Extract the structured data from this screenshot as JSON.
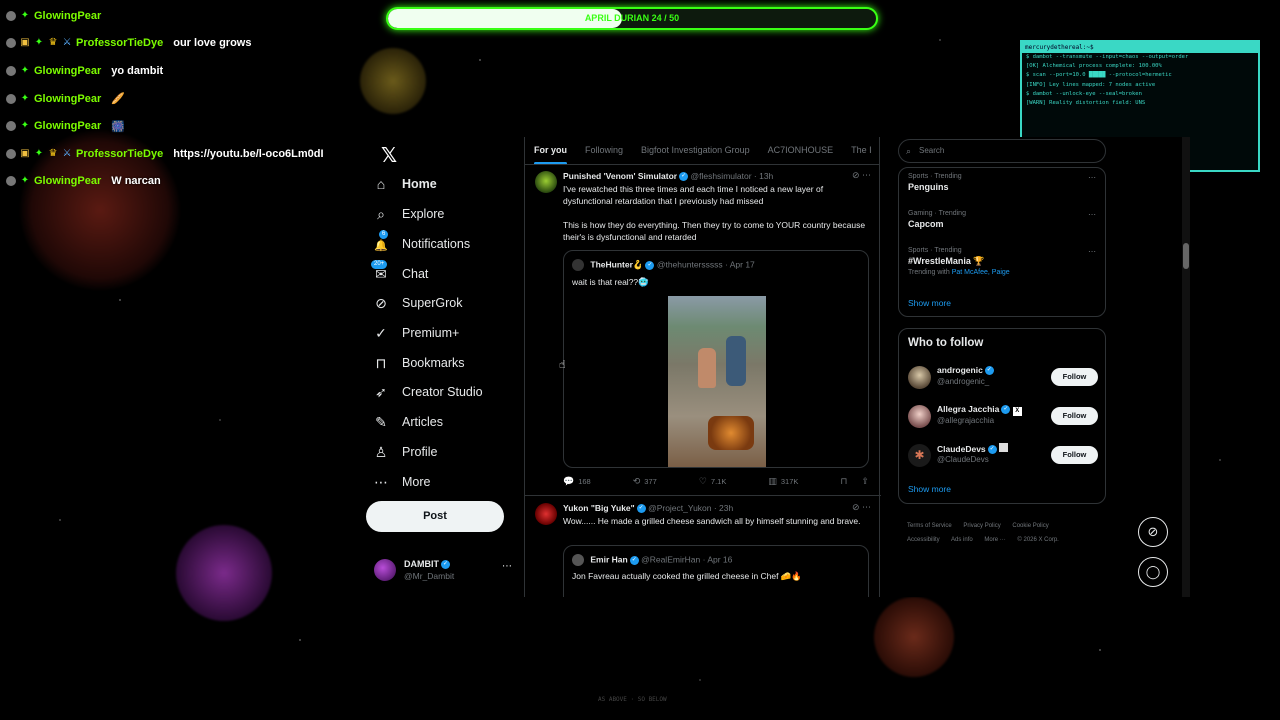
{
  "goal_bar": {
    "label": "APRIL DURIAN 24 / 50",
    "progress": 0.48
  },
  "chat": [
    {
      "user": "GlowingPear",
      "color": "#7cfc00",
      "text": "",
      "badges": [
        "dot-gray",
        "gem-green"
      ]
    },
    {
      "user": "ProfessorTieDye",
      "color": "#7cfc00",
      "text": "our love grows",
      "badges": [
        "dot-gray",
        "gift",
        "gem-green",
        "crown",
        "sword"
      ]
    },
    {
      "user": "GlowingPear",
      "color": "#7cfc00",
      "text": "yo dambit",
      "badges": [
        "dot-gray",
        "gem-green"
      ]
    },
    {
      "user": "GlowingPear",
      "color": "#7cfc00",
      "text": "🥖",
      "badges": [
        "dot-gray",
        "gem-green"
      ]
    },
    {
      "user": "GlowingPear",
      "color": "#7cfc00",
      "text": "🎆",
      "badges": [
        "dot-gray",
        "gem-green"
      ]
    },
    {
      "user": "ProfessorTieDye",
      "color": "#7cfc00",
      "text": "https://youtu.be/l-oco6Lm0dI",
      "badges": [
        "dot-gray",
        "gift",
        "gem-green",
        "crown",
        "sword"
      ]
    },
    {
      "user": "GlowingPear",
      "color": "#7cfc00",
      "text": "W narcan",
      "badges": [
        "dot-gray",
        "gem-green"
      ]
    }
  ],
  "terminal": {
    "title": "mercurydethereal:~$",
    "lines": [
      "$ dambot --transmute --input=chaos --output=order",
      "[OK] Alchemical process complete: 100.00%",
      "$ scan --port=10.0 █████ --protocol=hermetic",
      "[INFO] Ley lines mapped: 7 nodes active",
      "$ dambot --unlock-eye --seal=broken",
      "[WARN] Reality distortion field: UNS"
    ]
  },
  "nav": {
    "logo": "𝕏",
    "items": [
      {
        "label": "Home",
        "icon": "⌂",
        "name": "home"
      },
      {
        "label": "Explore",
        "icon": "⌕",
        "name": "explore"
      },
      {
        "label": "Notifications",
        "icon": "🔔",
        "name": "notifications",
        "badge": "6"
      },
      {
        "label": "Chat",
        "icon": "✉",
        "name": "chat",
        "badge": "20+"
      },
      {
        "label": "SuperGrok",
        "icon": "⊘",
        "name": "supergrok"
      },
      {
        "label": "Premium+",
        "icon": "✓",
        "name": "premium"
      },
      {
        "label": "Bookmarks",
        "icon": "⊓",
        "name": "bookmarks"
      },
      {
        "label": "Creator Studio",
        "icon": "➶",
        "name": "creator-studio"
      },
      {
        "label": "Articles",
        "icon": "✎",
        "name": "articles"
      },
      {
        "label": "Profile",
        "icon": "♙",
        "name": "profile"
      },
      {
        "label": "More",
        "icon": "⋯",
        "name": "more"
      }
    ],
    "post_label": "Post",
    "account": {
      "name": "DAMBIT",
      "handle": "@Mr_Dambit",
      "more": "⋯"
    }
  },
  "feed": {
    "tabs": [
      "For you",
      "Following",
      "Bigfoot Investigation Group",
      "AC7IONHOUSE",
      "The I"
    ],
    "tweets": [
      {
        "name": "Punished 'Venom' Simulator",
        "handle": "@fleshsimulator · 13h",
        "body": [
          "I've rewatched this three times and each time I noticed a new layer of dysfunctional retardation that I previously had missed",
          "This is how they do everything. Then they try to come to YOUR country because their's is dysfunctional and retarded"
        ],
        "quote": {
          "name": "TheHunter🪝",
          "handle": "@thehuntersssss · Apr 17",
          "body": "wait is that real??🥶"
        },
        "actions": {
          "replies": "168",
          "reposts": "377",
          "likes": "7.1K",
          "views": "317K"
        }
      },
      {
        "name": "Yukon \"Big Yuke\"",
        "handle": "@Project_Yukon · 23h",
        "body": [
          "Wow...... He made a grilled cheese sandwich all by himself stunning and brave."
        ],
        "quote": {
          "name": "Emir Han",
          "handle": "@RealEmirHan · Apr 16",
          "body": "Jon Favreau actually cooked the grilled cheese in Chef 🧀🔥"
        }
      }
    ]
  },
  "sidebar": {
    "search_placeholder": "Search",
    "trends": [
      {
        "category": "Sports · Trending",
        "name": "Penguins"
      },
      {
        "category": "Gaming · Trending",
        "name": "Capcom"
      },
      {
        "category": "Sports · Trending",
        "name": "#WrestleMania 🏆",
        "with_label": "Trending with ",
        "with": "Pat McAfee, Paige"
      }
    ],
    "trends_show_more": "Show more",
    "who_to_follow_title": "Who to follow",
    "suggestions": [
      {
        "name": "androgenic",
        "handle": "@androgenic_",
        "button": "Follow"
      },
      {
        "name": "Allegra Jacchia",
        "handle": "@allegrajacchia",
        "button": "Follow"
      },
      {
        "name": "ClaudeDevs",
        "handle": "@ClaudeDevs",
        "button": "Follow"
      }
    ],
    "wtf_show_more": "Show more",
    "footer": [
      "Terms of Service",
      "Privacy Policy",
      "Cookie Policy",
      "Accessibility",
      "Ads info",
      "More ···",
      "© 2026 X Corp."
    ]
  },
  "overlay_bottom": "AS ABOVE · SO BELOW",
  "colors": {
    "accent": "#1d9bf0",
    "chat_name": "#7cfc00",
    "goal": "#39ff14",
    "terminal": "#3ad8c5"
  }
}
